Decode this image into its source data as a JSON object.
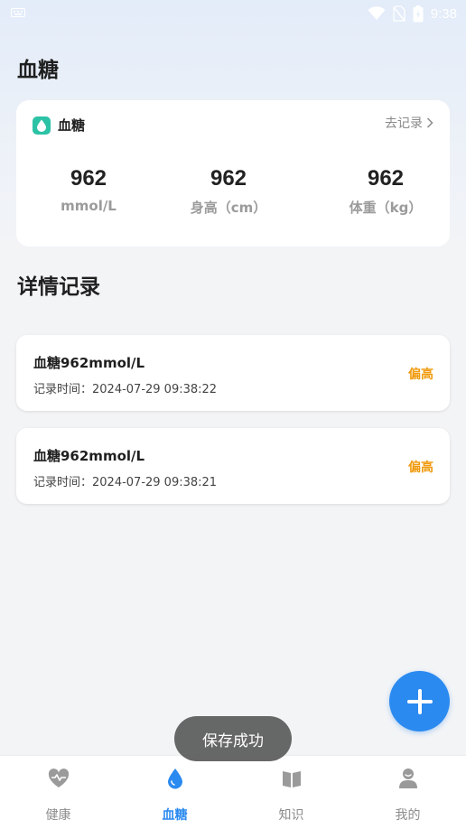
{
  "status_bar": {
    "time": "9:38",
    "icons": [
      "keyboard-icon",
      "wifi-icon",
      "no-sim-icon",
      "battery-icon"
    ]
  },
  "page": {
    "title": "血糖"
  },
  "summary_card": {
    "title": "血糖",
    "icon": "water-drop-icon",
    "link_label": "去记录",
    "stats": [
      {
        "value": "962",
        "unit": "mmol/L"
      },
      {
        "value": "962",
        "unit": "身高（cm）"
      },
      {
        "value": "962",
        "unit": "体重（kg）"
      }
    ]
  },
  "details": {
    "title": "详情记录",
    "records": [
      {
        "value": "血糖962mmol/L",
        "time": "记录时间：2024-07-29 09:38:22",
        "status": "偏高"
      },
      {
        "value": "血糖962mmol/L",
        "time": "记录时间：2024-07-29 09:38:21",
        "status": "偏高"
      }
    ]
  },
  "toast": {
    "text": "保存成功"
  },
  "bottom_nav": {
    "items": [
      {
        "label": "健康",
        "icon": "heart-pulse-icon"
      },
      {
        "label": "血糖",
        "icon": "water-drop-icon",
        "active": true
      },
      {
        "label": "知识",
        "icon": "book-icon"
      },
      {
        "label": "我的",
        "icon": "user-icon"
      }
    ]
  },
  "colors": {
    "accent": "#2b8af0",
    "badge": "#2cc2a6",
    "warning": "#f09a0c"
  }
}
